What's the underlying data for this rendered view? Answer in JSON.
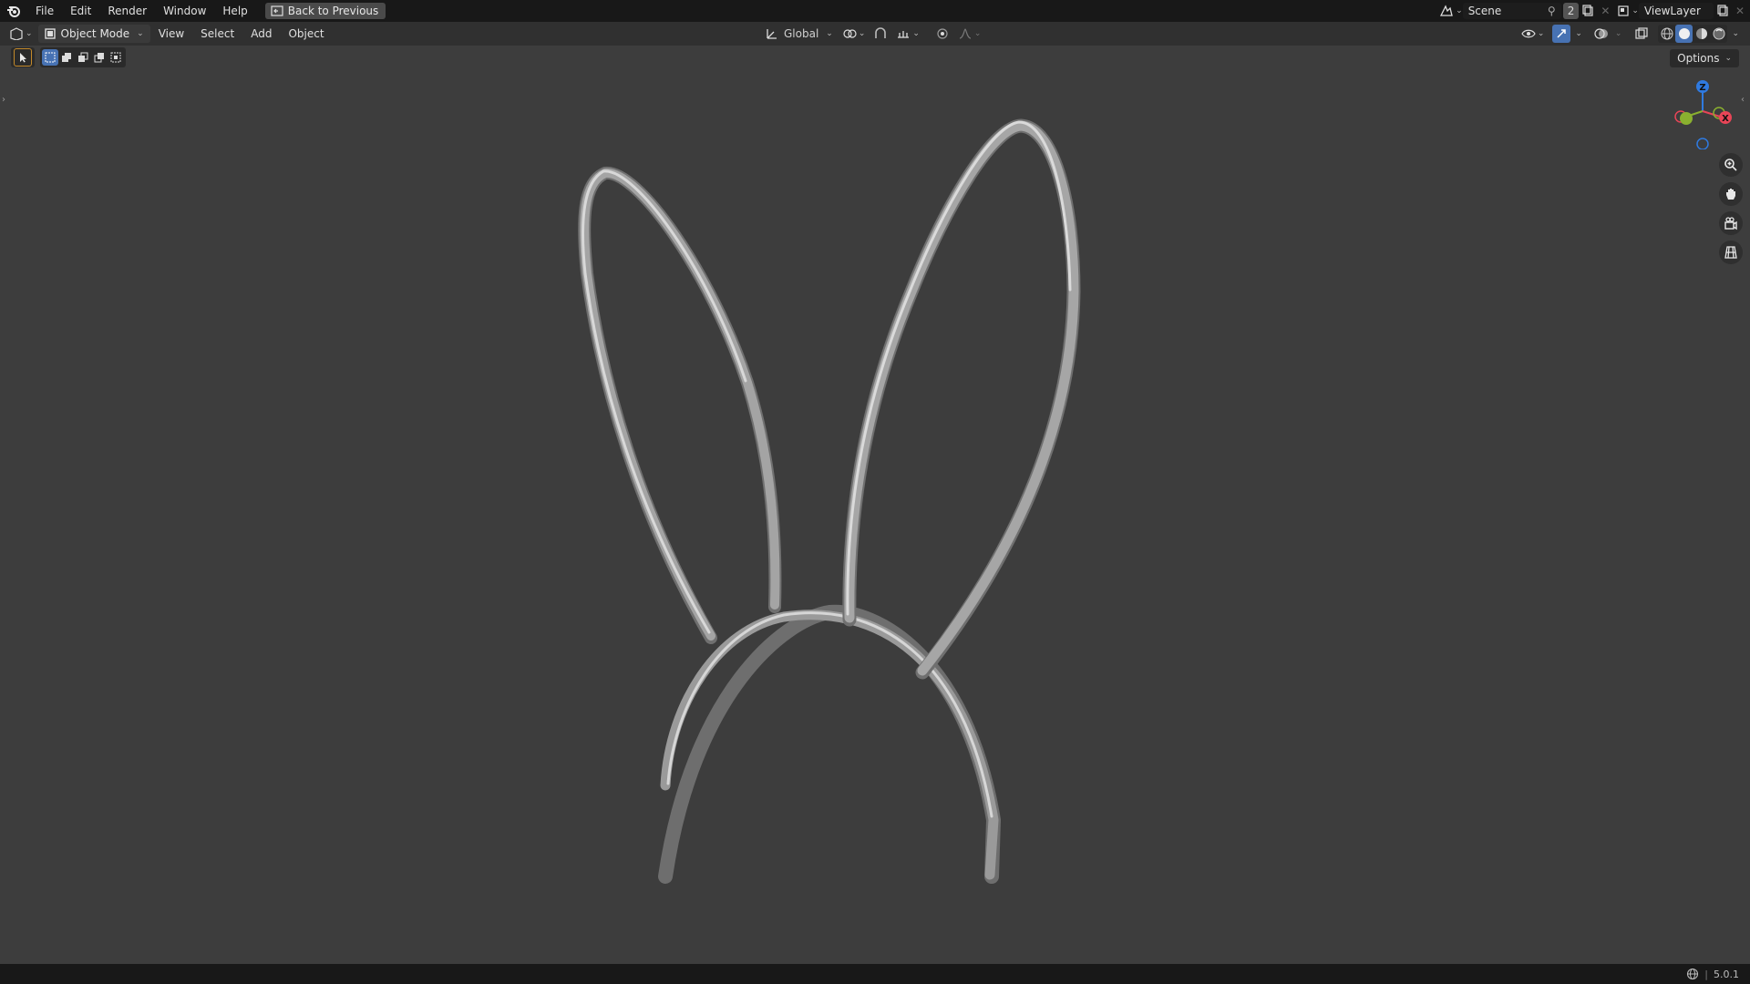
{
  "topbar": {
    "menu": [
      "File",
      "Edit",
      "Render",
      "Window",
      "Help"
    ],
    "back_button": "Back to Previous",
    "scene": "Scene",
    "scene_users": "2",
    "view_layer": "ViewLayer"
  },
  "header": {
    "mode": "Object Mode",
    "menus": [
      "View",
      "Select",
      "Add",
      "Object"
    ],
    "transform_orientation": "Global"
  },
  "options_label": "Options",
  "gizmo": {
    "z": "Z",
    "x": "X"
  },
  "status": {
    "version": "5.0.1"
  },
  "colors": {
    "background": "#3d3d3d",
    "accent": "#4772b3",
    "axis_x": "#e84557",
    "axis_y": "#8ab02f",
    "axis_z": "#2f7ae0"
  },
  "icons": [
    "blender-logo-icon",
    "back-icon",
    "scene-icon",
    "pin-icon",
    "new-scene-icon",
    "view-layer-icon",
    "editor-type-icon",
    "object-mode-icon",
    "transform-orientation-icon",
    "pivot-icon",
    "snap-icon",
    "proportional-edit-icon",
    "visibility-icon",
    "gizmo-icon",
    "overlay-icon",
    "xray-icon",
    "wireframe-shading-icon",
    "solid-shading-icon",
    "material-shading-icon",
    "rendered-shading-icon",
    "select-tool-icon",
    "zoom-icon",
    "pan-hand-icon",
    "camera-view-icon",
    "perspective-grid-icon"
  ]
}
